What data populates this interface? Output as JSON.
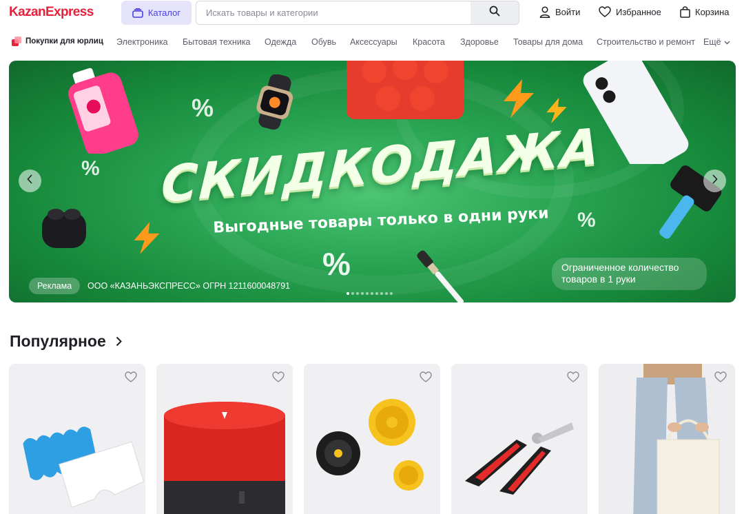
{
  "header": {
    "logo_part1": "Kazan",
    "logo_part2": "Express",
    "catalog_label": "Каталог",
    "search_placeholder": "Искать товары и категории",
    "login_label": "Войти",
    "favorites_label": "Избранное",
    "cart_label": "Корзина"
  },
  "categories": {
    "business": "Покупки для юрлиц",
    "items": [
      "Электроника",
      "Бытовая техника",
      "Одежда",
      "Обувь",
      "Аксессуары",
      "Красота",
      "Здоровье",
      "Товары для дома",
      "Строительство и ремонт"
    ],
    "more": "Ещё"
  },
  "banner": {
    "title": "СКИДКОДАЖА",
    "subtitle": "Выгодные товары только в одни руки",
    "ad_label": "Реклама",
    "ad_org": "ООО «КАЗАНЬЭКСПРЕСС» ОГРН 1211600048791",
    "limited_text": "Ограниченное количество товаров в 1 руки",
    "slide_count": 10,
    "active_slide": 1
  },
  "popular": {
    "title": "Популярное",
    "products": [
      {
        "name": "sponge-filter"
      },
      {
        "name": "smart-speaker"
      },
      {
        "name": "drill-brushes"
      },
      {
        "name": "nail-clipper"
      },
      {
        "name": "tote-bag"
      }
    ]
  },
  "colors": {
    "brand_red": "#e6213c",
    "brand_purple": "#4a3fe0",
    "banner_green": "#2aa654"
  }
}
